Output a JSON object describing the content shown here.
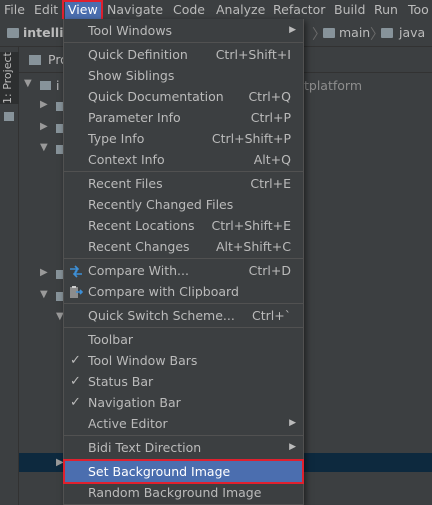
{
  "menubar": {
    "items": [
      "File",
      "Edit",
      "View",
      "Navigate",
      "Code",
      "Analyze",
      "Refactor",
      "Build",
      "Run",
      "Too"
    ]
  },
  "navbar": {
    "project": "intellig",
    "crumbs": [
      "main",
      "java"
    ]
  },
  "toolwindow": {
    "project_tab": "1: Project",
    "panel_title": "Pro",
    "tree_root": "i",
    "tree_hint": "tplatform"
  },
  "view_menu": {
    "items": [
      {
        "label": "Tool Windows",
        "shortcut": "",
        "submenu": true
      },
      {
        "label": "Quick Definition",
        "shortcut": "Ctrl+Shift+I"
      },
      {
        "label": "Show Siblings",
        "shortcut": ""
      },
      {
        "label": "Quick Documentation",
        "shortcut": "Ctrl+Q"
      },
      {
        "label": "Parameter Info",
        "shortcut": "Ctrl+P"
      },
      {
        "label": "Type Info",
        "shortcut": "Ctrl+Shift+P"
      },
      {
        "label": "Context Info",
        "shortcut": "Alt+Q"
      },
      {
        "label": "Recent Files",
        "shortcut": "Ctrl+E"
      },
      {
        "label": "Recently Changed Files",
        "shortcut": ""
      },
      {
        "label": "Recent Locations",
        "shortcut": "Ctrl+Shift+E"
      },
      {
        "label": "Recent Changes",
        "shortcut": "Alt+Shift+C"
      },
      {
        "label": "Compare With...",
        "shortcut": "Ctrl+D",
        "icon": "compare-icon"
      },
      {
        "label": "Compare with Clipboard",
        "shortcut": "",
        "icon": "compare-clipboard-icon"
      },
      {
        "label": "Quick Switch Scheme...",
        "shortcut": "Ctrl+`"
      },
      {
        "label": "Toolbar",
        "shortcut": "",
        "checked": false
      },
      {
        "label": "Tool Window Bars",
        "shortcut": "",
        "checked": true
      },
      {
        "label": "Status Bar",
        "shortcut": "",
        "checked": true
      },
      {
        "label": "Navigation Bar",
        "shortcut": "",
        "checked": true
      },
      {
        "label": "Active Editor",
        "shortcut": "",
        "submenu": true
      },
      {
        "label": "Bidi Text Direction",
        "shortcut": "",
        "submenu": true
      },
      {
        "label": "Set Background Image",
        "shortcut": "",
        "selected": true
      },
      {
        "label": "Random Background Image",
        "shortcut": ""
      }
    ]
  },
  "glyphs": {
    "check": "✓",
    "submenu": "▶",
    "chevron": "〉",
    "arrow_right": "▶",
    "arrow_down": "▼"
  },
  "colors": {
    "menu_bg": "#3c3f41",
    "selection": "#4b6eaf",
    "highlight_box": "#e0202e",
    "text": "#bbbbbb"
  }
}
